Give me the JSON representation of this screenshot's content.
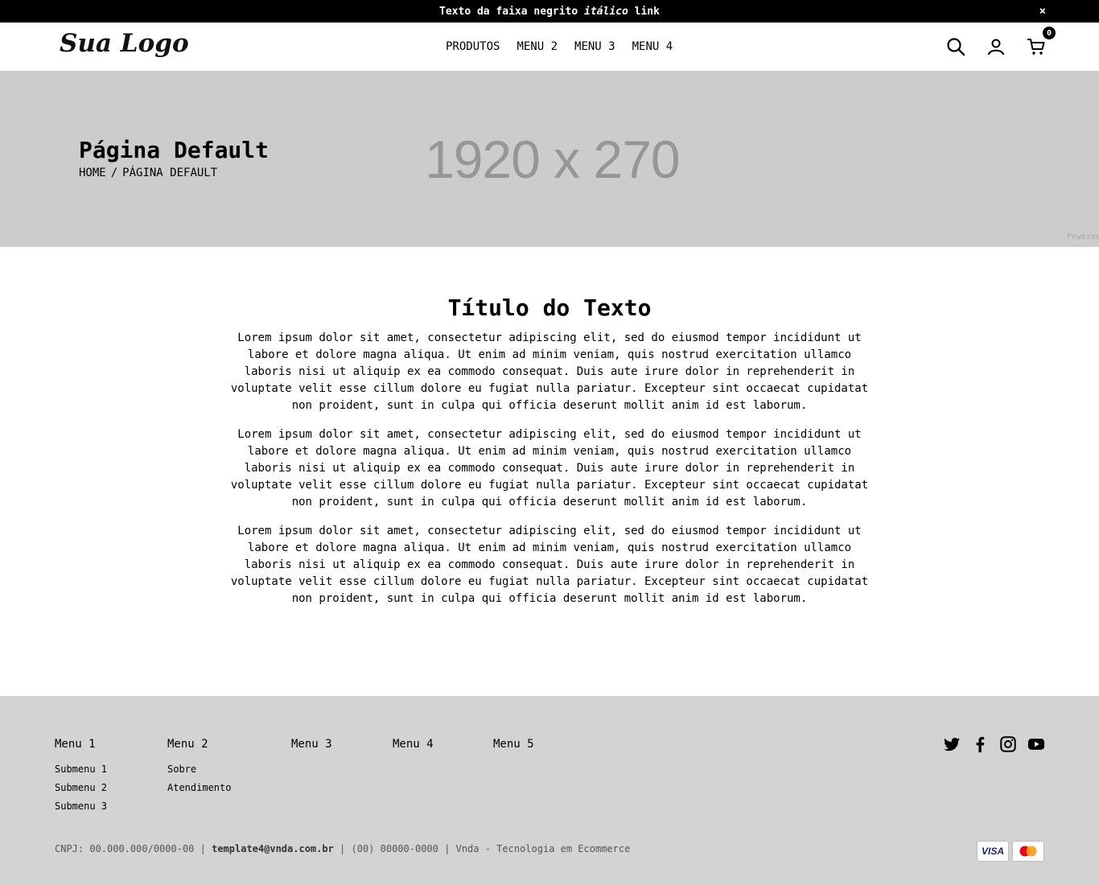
{
  "topbar": {
    "text_bold": "Texto da faixa negrito",
    "text_italic": "itálico",
    "text_link": "link",
    "close_label": "×"
  },
  "header": {
    "logo": "Sua Logo",
    "nav": [
      "PRODUTOS",
      "MENU 2",
      "MENU 3",
      "MENU 4"
    ],
    "cart_count": "0",
    "icons": [
      "search-icon",
      "user-icon",
      "cart-icon"
    ]
  },
  "banner": {
    "title": "Página Default",
    "breadcrumb": [
      "HOME",
      "/",
      "PÁGINA DEFAULT"
    ],
    "placeholder": "1920 x 270",
    "powered": "Powered",
    "bg_color": "#cccccc"
  },
  "content": {
    "title": "Título do Texto",
    "paragraphs": [
      "Lorem ipsum dolor sit amet, consectetur adipiscing elit, sed do eiusmod tempor incididunt ut labore et dolore magna aliqua. Ut enim ad minim veniam, quis nostrud exercitation ullamco laboris nisi ut aliquip ex ea commodo consequat. Duis aute irure dolor in reprehenderit in voluptate velit esse cillum dolore eu fugiat nulla pariatur. Excepteur sint occaecat cupidatat non proident, sunt in culpa qui officia deserunt mollit anim id est laborum.",
      "Lorem ipsum dolor sit amet, consectetur adipiscing elit, sed do eiusmod tempor incididunt ut labore et dolore magna aliqua. Ut enim ad minim veniam, quis nostrud exercitation ullamco laboris nisi ut aliquip ex ea commodo consequat. Duis aute irure dolor in reprehenderit in voluptate velit esse cillum dolore eu fugiat nulla pariatur. Excepteur sint occaecat cupidatat non proident, sunt in culpa qui officia deserunt mollit anim id est laborum.",
      "Lorem ipsum dolor sit amet, consectetur adipiscing elit, sed do eiusmod tempor incididunt ut labore et dolore magna aliqua. Ut enim ad minim veniam, quis nostrud exercitation ullamco laboris nisi ut aliquip ex ea commodo consequat. Duis aute irure dolor in reprehenderit in voluptate velit esse cillum dolore eu fugiat nulla pariatur. Excepteur sint occaecat cupidatat non proident, sunt in culpa qui officia deserunt mollit anim id est laborum."
    ]
  },
  "footer": {
    "bg_color": "#d3d3d3",
    "columns": [
      {
        "title": "Menu 1",
        "items": [
          "Submenu 1",
          "Submenu 2",
          "Submenu 3"
        ]
      },
      {
        "title": "Menu 2",
        "items": [
          "Sobre",
          "Atendimento"
        ]
      },
      {
        "title": "Menu 3",
        "items": []
      },
      {
        "title": "Menu 4",
        "items": []
      },
      {
        "title": "Menu 5",
        "items": []
      }
    ],
    "social": [
      "twitter-icon",
      "facebook-icon",
      "instagram-icon",
      "youtube-icon"
    ],
    "bottom": {
      "cnpj": "CNPJ: 00.000.000/0000-00",
      "sep1": "|",
      "email": "template4@vnda.com.br",
      "sep2": "|",
      "phone": "(00) 00000-0000",
      "sep3": "|",
      "credit": "Vnda - Tecnologia em Ecommerce"
    },
    "payments": [
      "VISA",
      "mastercard"
    ]
  }
}
